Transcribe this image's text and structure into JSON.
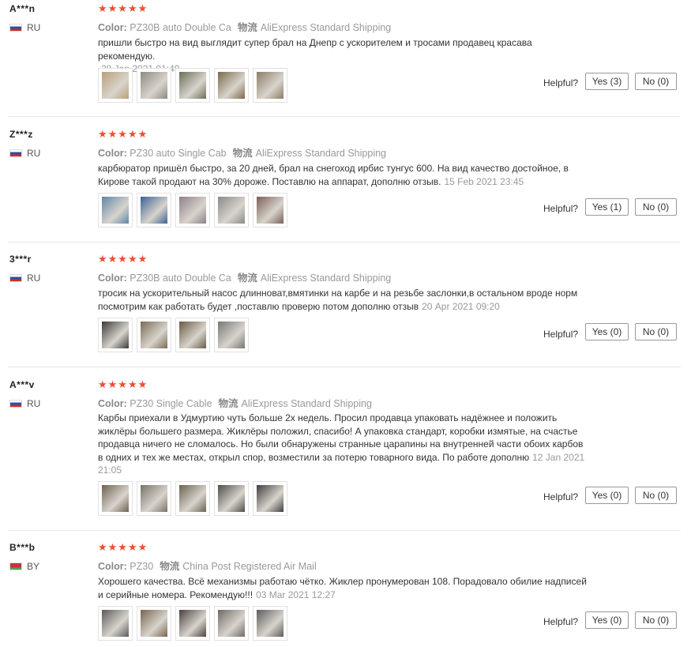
{
  "labels": {
    "color": "Color:",
    "logistics": "物流",
    "helpful": "Helpful?"
  },
  "reviews": [
    {
      "user": "A***n",
      "country": "RU",
      "color": "PZ30B auto Double Ca",
      "shipping": "AliExpress Standard Shipping",
      "text": "пришли быстро на вид выглядит супер брал на Днепр с ускорителем и тросами продавец красава рекомендую.",
      "date": "28 Jan 2021 01:49",
      "yes": "Yes (3)",
      "no": "No (0)",
      "photo_colors": [
        "#b8a07a",
        "#8e8a80",
        "#6b6f5a",
        "#7a6a4c",
        "#8c7c66"
      ]
    },
    {
      "user": "Z***z",
      "country": "RU",
      "color": "PZ30 auto Single Cab",
      "shipping": "AliExpress Standard Shipping",
      "text": "карбюратор пришёл быстро, за 20 дней, брал на снегоход ирбис тунгус 600. На вид качество достойное, в Кирове такой продают на 30% дороже. Поставлю на аппарат, дополню отзыв.",
      "date": "15 Feb 2021 23:45",
      "yes": "Yes (1)",
      "no": "No (0)",
      "photo_colors": [
        "#5f86a8",
        "#3d5f95",
        "#8f7f8a",
        "#8a8a8a",
        "#7a5f58"
      ]
    },
    {
      "user": "3***r",
      "country": "RU",
      "color": "PZ30B auto Double Ca",
      "shipping": "AliExpress Standard Shipping",
      "text": "тросик на ускорительный насос длиннoват,вмятинки на карбе и на резьбе заслонки,в остальном вроде норм посмотрим как работать будет ,поставлю проверю потом дополню отзыв",
      "date": "20 Apr 2021 09:20",
      "yes": "Yes (0)",
      "no": "No (0)",
      "photo_colors": [
        "#3a3a3a",
        "#7b6b55",
        "#6a5a45",
        "#777777"
      ]
    },
    {
      "user": "A***v",
      "country": "RU",
      "color": "PZ30 Single Cable",
      "shipping": "AliExpress Standard Shipping",
      "text": "Карбы приехали в Удмуртию чуть больше 2х недель. Просил продавца упаковать надёжнее и положить жиклёры большего размера. Жиклёры положил, спасибо! А упаковка стандарт, коробки измятые, на счастье продавца ничего не сломалось. Но были обнаружены странные царапины на внутренней части обоих карбов в одних и тех же местах, открыл спор, возместили за потерю товарного вида. По работе дополню",
      "date": "12 Jan 2021 21:05",
      "yes": "Yes (0)",
      "no": "No (0)",
      "photo_colors": [
        "#6e6252",
        "#7a7266",
        "#6b6352",
        "#4d4d4a",
        "#3f3f3f"
      ]
    },
    {
      "user": "B***b",
      "country": "BY",
      "color": "PZ30",
      "shipping": "China Post Registered Air Mail",
      "text": "Хорошего качества. Всё механизмы работаю чётко. Жиклер пронумерован 108. Порадовало обилие надписей и серийные номера. Рекомендую!!!",
      "date": "03 Mar 2021 12:27",
      "yes": "Yes (0)",
      "no": "No (0)",
      "photo_colors": [
        "#5a5a5a",
        "#7a6450",
        "#4a4040",
        "#6e6a66",
        "#5c5c5c"
      ]
    }
  ]
}
